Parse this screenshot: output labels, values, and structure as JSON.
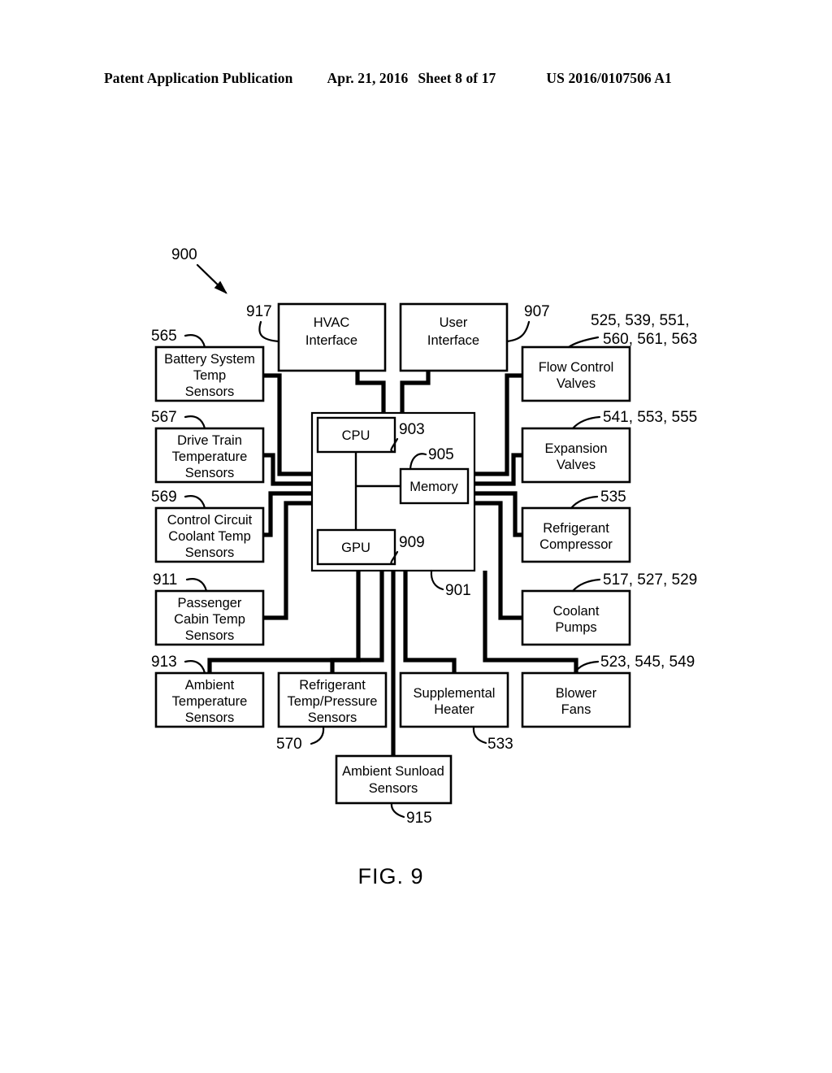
{
  "header": {
    "left": "Patent Application Publication",
    "date": "Apr. 21, 2016",
    "sheet": "Sheet 8 of 17",
    "pub_number": "US 2016/0107506 A1"
  },
  "figure": {
    "caption": "FIG. 9",
    "system_ref": "900"
  },
  "blocks": {
    "hvac_interface": {
      "line1": "HVAC",
      "line2": "Interface",
      "ref": "917"
    },
    "user_interface": {
      "line1": "User",
      "line2": "Interface",
      "ref": "907"
    },
    "controller": {
      "ref": "901"
    },
    "cpu": {
      "label": "CPU",
      "ref": "903"
    },
    "memory": {
      "label": "Memory",
      "ref": "905"
    },
    "gpu": {
      "label": "GPU",
      "ref": "909"
    },
    "battery_system_temp_sensors": {
      "line1": "Battery System",
      "line2": "Temp",
      "line3": "Sensors",
      "ref": "565"
    },
    "drive_train_temperature_sensors": {
      "line1": "Drive Train",
      "line2": "Temperature",
      "line3": "Sensors",
      "ref": "567"
    },
    "control_circuit_coolant_temp_sensors": {
      "line1": "Control Circuit",
      "line2": "Coolant Temp",
      "line3": "Sensors",
      "ref": "569"
    },
    "passenger_cabin_temp_sensors": {
      "line1": "Passenger",
      "line2": "Cabin Temp",
      "line3": "Sensors",
      "ref": "911"
    },
    "ambient_temperature_sensors": {
      "line1": "Ambient",
      "line2": "Temperature",
      "line3": "Sensors",
      "ref": "913"
    },
    "refrigerant_temp_pressure_sensors": {
      "line1": "Refrigerant",
      "line2": "Temp/Pressure",
      "line3": "Sensors",
      "ref": "570"
    },
    "supplemental_heater": {
      "line1": "Supplemental",
      "line2": "Heater",
      "ref": "533"
    },
    "blower_fans": {
      "line1": "Blower",
      "line2": "Fans",
      "ref": "523, 545, 549"
    },
    "ambient_sunload_sensors": {
      "line1": "Ambient Sunload",
      "line2": "Sensors",
      "ref": "915"
    },
    "flow_control_valves": {
      "line1": "Flow Control",
      "line2": "Valves",
      "ref_line1": "525, 539, 551,",
      "ref_line2": "560, 561, 563"
    },
    "expansion_valves": {
      "line1": "Expansion",
      "line2": "Valves",
      "ref": "541, 553, 555"
    },
    "refrigerant_compressor": {
      "line1": "Refrigerant",
      "line2": "Compressor",
      "ref": "535"
    },
    "coolant_pumps": {
      "line1": "Coolant",
      "line2": "Pumps",
      "ref": "517, 527, 529"
    }
  }
}
